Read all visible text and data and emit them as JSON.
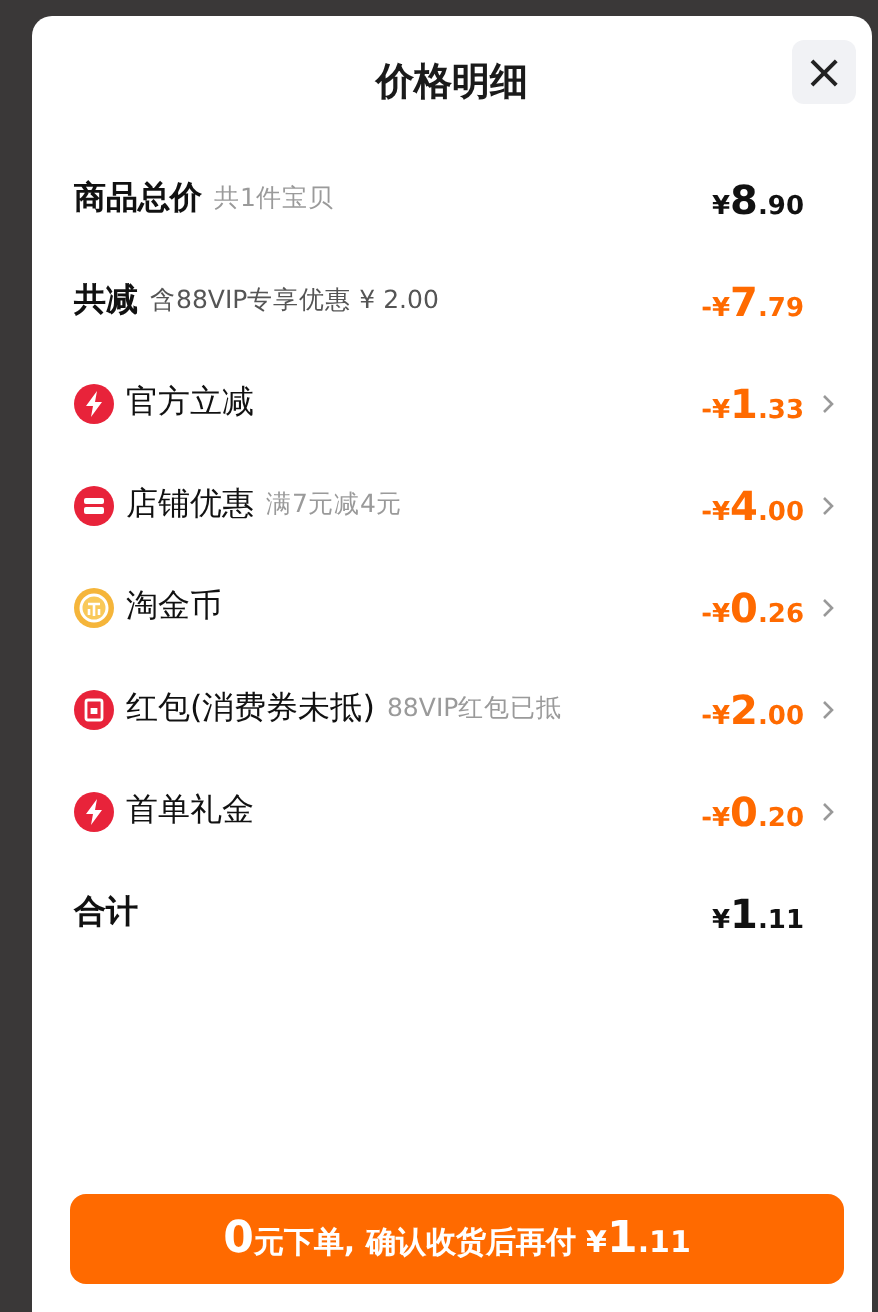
{
  "sheet": {
    "title": "价格明细",
    "close": "×"
  },
  "rows": [
    {
      "kind": "header",
      "label": "商品总价",
      "note": "共1件宝贝",
      "amount": {
        "sign": "¥",
        "int": "8",
        "dec": ".90"
      },
      "discount": false,
      "arrow": false
    },
    {
      "kind": "header",
      "label": "共减",
      "note": "含88VIP专享优惠 ¥ 2.00",
      "amount": {
        "sign": "-¥",
        "int": "7",
        "dec": ".79"
      },
      "discount": true,
      "arrow": false
    },
    {
      "kind": "bolt",
      "label": "官方立减",
      "amount": {
        "sign": "-¥",
        "int": "1",
        "dec": ".33"
      },
      "discount": true,
      "arrow": true
    },
    {
      "kind": "shop",
      "label": "店铺优惠",
      "note": "满7元减4元",
      "amount": {
        "sign": "-¥",
        "int": "4",
        "dec": ".00"
      },
      "discount": true,
      "arrow": true
    },
    {
      "kind": "coin",
      "label": "淘金币",
      "amount": {
        "sign": "-¥",
        "int": "0",
        "dec": ".26"
      },
      "discount": true,
      "arrow": true
    },
    {
      "kind": "packet",
      "label": "红包(消费券未抵)",
      "note": "88VIP红包已抵",
      "amount": {
        "sign": "-¥",
        "int": "2",
        "dec": ".00"
      },
      "discount": true,
      "arrow": true
    },
    {
      "kind": "bolt",
      "label": "首单礼金",
      "amount": {
        "sign": "-¥",
        "int": "0",
        "dec": ".20"
      },
      "discount": true,
      "arrow": true
    },
    {
      "kind": "total",
      "label": "合计",
      "amount": {
        "sign": "¥",
        "int": "1",
        "dec": ".11"
      },
      "discount": false,
      "arrow": false
    }
  ],
  "pay_button": [
    "0",
    "元下单, 确认收货后再付 ¥",
    "1",
    ".11"
  ]
}
